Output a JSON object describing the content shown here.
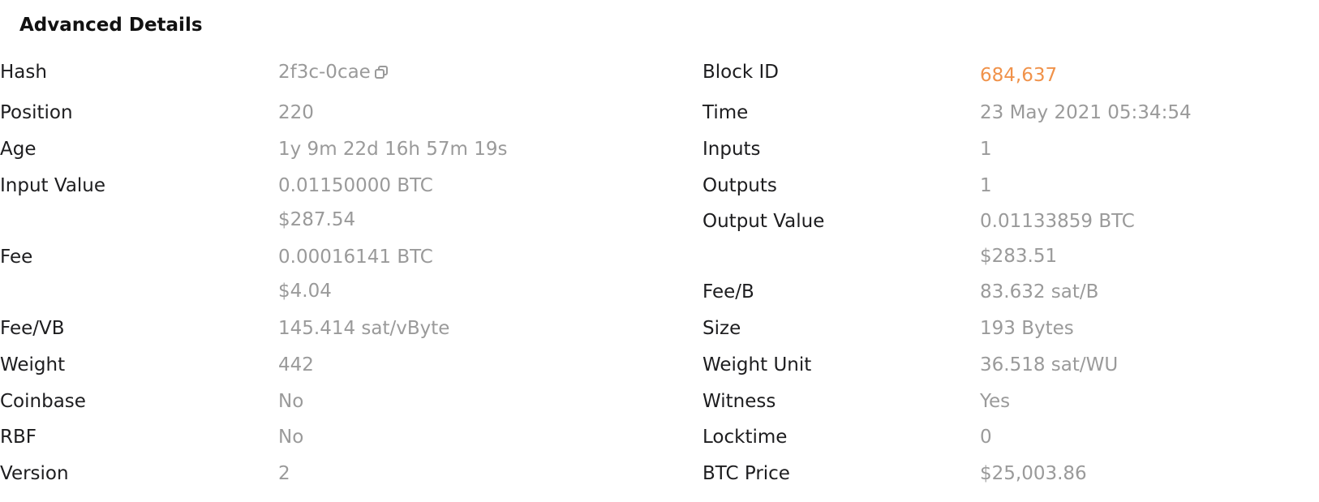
{
  "section_title": "Advanced Details",
  "left": {
    "hash_label": "Hash",
    "hash_value": "2f3c-0cae",
    "copy_icon": "copy-icon",
    "position_label": "Position",
    "position_value": "220",
    "age_label": "Age",
    "age_value": "1y 9m 22d 16h 57m 19s",
    "input_value_label": "Input Value",
    "input_value_btc": "0.01150000 BTC",
    "input_value_usd": "$287.54",
    "fee_label": "Fee",
    "fee_btc": "0.00016141 BTC",
    "fee_usd": "$4.04",
    "fee_vb_label": "Fee/VB",
    "fee_vb_value": "145.414 sat/vByte",
    "weight_label": "Weight",
    "weight_value": "442",
    "coinbase_label": "Coinbase",
    "coinbase_value": "No",
    "rbf_label": "RBF",
    "rbf_value": "No",
    "version_label": "Version",
    "version_value": "2"
  },
  "right": {
    "block_id_label": "Block ID",
    "block_id_value": "684,637",
    "time_label": "Time",
    "time_value": "23 May 2021 05:34:54",
    "inputs_label": "Inputs",
    "inputs_value": "1",
    "outputs_label": "Outputs",
    "outputs_value": "1",
    "output_value_label": "Output Value",
    "output_value_btc": "0.01133859 BTC",
    "output_value_usd": "$283.51",
    "fee_b_label": "Fee/B",
    "fee_b_value": "83.632 sat/B",
    "size_label": "Size",
    "size_value": "193 Bytes",
    "weight_unit_label": "Weight Unit",
    "weight_unit_value": "36.518 sat/WU",
    "witness_label": "Witness",
    "witness_value": "Yes",
    "locktime_label": "Locktime",
    "locktime_value": "0",
    "btc_price_label": "BTC Price",
    "btc_price_value": "$25,003.86"
  },
  "colors": {
    "label": "#1d1d1f",
    "value": "#9a9a9a",
    "accent": "#f0924a"
  }
}
